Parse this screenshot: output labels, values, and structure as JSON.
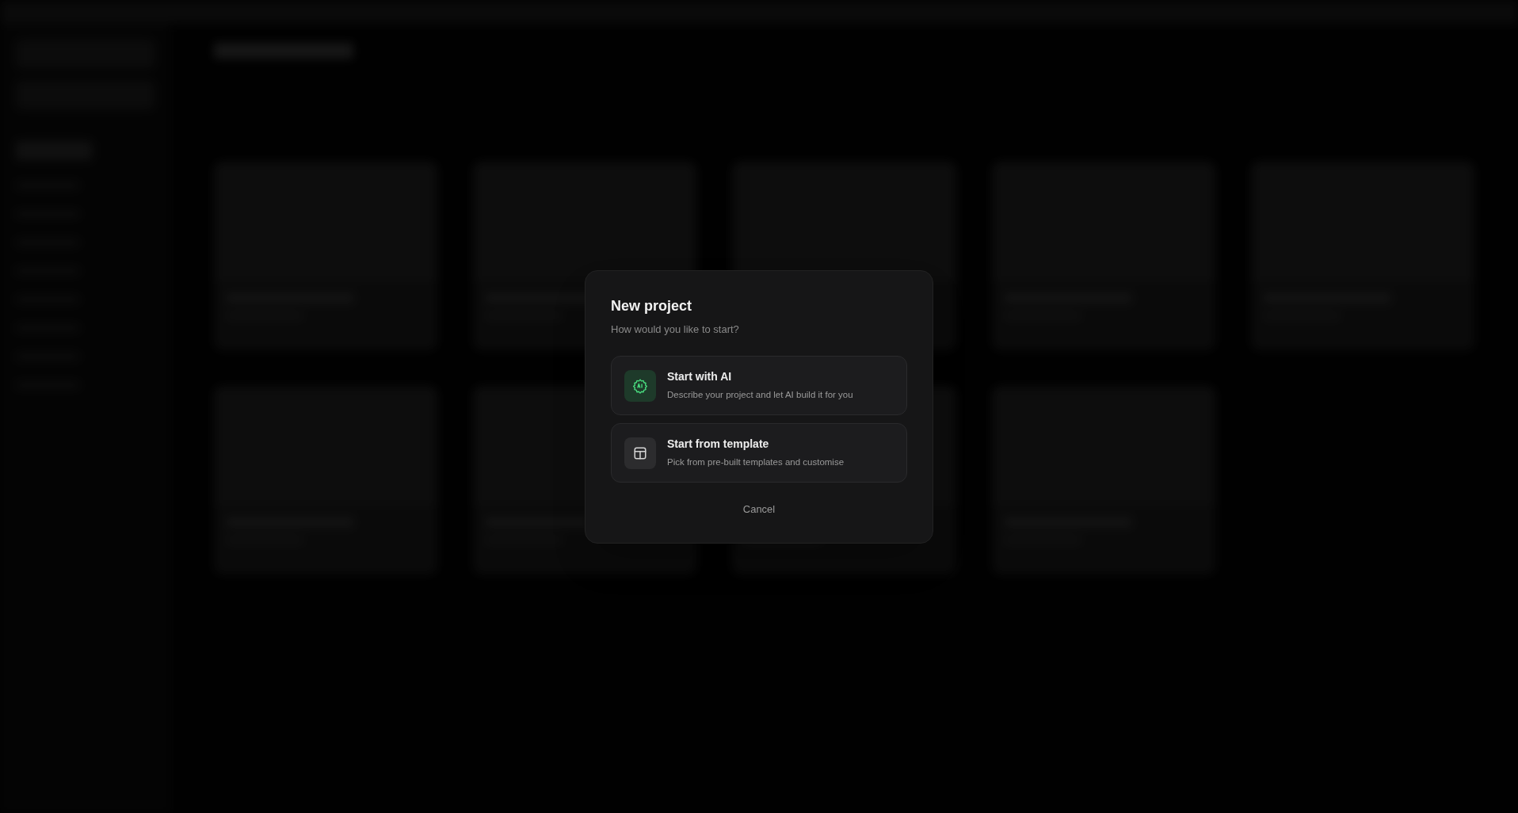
{
  "dialog": {
    "title": "New project",
    "subtitle": "How would you like to start?",
    "options": [
      {
        "kind": "ai",
        "title": "Start with AI",
        "description": "Describe your project and let AI build it for you"
      },
      {
        "kind": "template",
        "title": "Start from template",
        "description": "Pick from pre-built templates and customise"
      }
    ],
    "cancel": "Cancel"
  }
}
